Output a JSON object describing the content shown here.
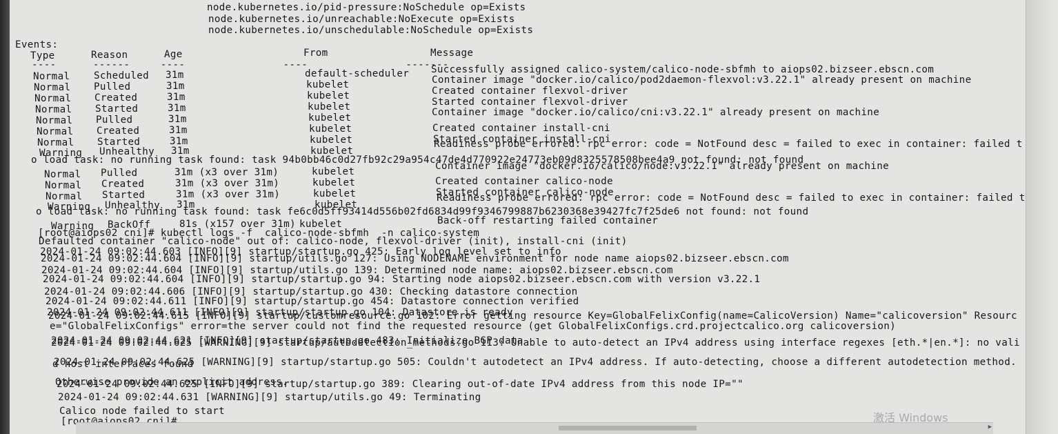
{
  "terminal": {
    "top_tolerations": [
      "node.kubernetes.io/pid-pressure:NoSchedule op=Exists",
      "node.kubernetes.io/unreachable:NoExecute op=Exists",
      "node.kubernetes.io/unschedulable:NoSchedule op=Exists"
    ],
    "events_label": "Events:",
    "events_header": {
      "type": "Type",
      "reason": "Reason",
      "age": "Age",
      "from": "From",
      "message": "Message"
    },
    "events_rows": [
      {
        "type": "Normal",
        "reason": "Scheduled",
        "age": "31m",
        "from": "default-scheduler",
        "message": "Successfully assigned calico-system/calico-node-sbfmh to aiops02.bizseer.ebscn.com"
      },
      {
        "type": "Normal",
        "reason": "Pulled",
        "age": "31m",
        "from": "kubelet",
        "message": "Container image \"docker.io/calico/pod2daemon-flexvol:v3.22.1\" already present on machine"
      },
      {
        "type": "Normal",
        "reason": "Created",
        "age": "31m",
        "from": "kubelet",
        "message": "Created container flexvol-driver"
      },
      {
        "type": "Normal",
        "reason": "Started",
        "age": "31m",
        "from": "kubelet",
        "message": "Started container flexvol-driver"
      },
      {
        "type": "Normal",
        "reason": "Pulled",
        "age": "31m",
        "from": "kubelet",
        "message": "Container image \"docker.io/calico/cni:v3.22.1\" already present on machine"
      },
      {
        "type": "Normal",
        "reason": "Created",
        "age": "31m",
        "from": "kubelet",
        "message": "Created container install-cni"
      },
      {
        "type": "Normal",
        "reason": "Started",
        "age": "31m",
        "from": "kubelet",
        "message": "Started container install-cni"
      },
      {
        "type": "Warning",
        "reason": "Unhealthy",
        "age": "31m",
        "from": "kubelet",
        "message": "Readiness probe errored: rpc error: code = NotFound desc = failed to exec in container: failed t"
      }
    ],
    "events_wrap_1": "o load task: no running task found: task 94b0bb46c0d27fb92c29a954c47de4d770922e24773eb09d8325578508bee4a9 not found: not found",
    "events_rows_2": [
      {
        "type": "Normal",
        "reason": "Pulled",
        "age": "31m (x3 over 31m)",
        "from": "kubelet",
        "message": "Container image \"docker.io/calico/node:v3.22.1\" already present on machine"
      },
      {
        "type": "Normal",
        "reason": "Created",
        "age": "31m (x3 over 31m)",
        "from": "kubelet",
        "message": "Created container calico-node"
      },
      {
        "type": "Normal",
        "reason": "Started",
        "age": "31m (x3 over 31m)",
        "from": "kubelet",
        "message": "Started container calico-node"
      },
      {
        "type": "Warning",
        "reason": "Unhealthy",
        "age": "31m",
        "from": "kubelet",
        "message": "Readiness probe errored: rpc error: code = NotFound desc = failed to exec in container: failed t"
      }
    ],
    "events_wrap_2": "o load task: no running task found: task fe6c0d5ff93414d556b02fd6834d99f9346799887b6230368e39427fc7f25de6 not found: not found",
    "events_row_backoff": {
      "type": "Warning",
      "reason": "BackOff",
      "age": "81s (x157 over 31m)",
      "from": "kubelet",
      "message": "Back-off restarting failed container"
    },
    "prompt_cmd": "[root@aiops02 cni]# kubectl logs -f  calico-node-sbfmh  -n calico-system",
    "defaulted_line": "Defaulted container \"calico-node\" out of: calico-node, flexvol-driver (init), install-cni (init)",
    "log_lines": [
      "2024-01-24 09:02:44.603 [INFO][9] startup/startup.go 425: Early log level set to info",
      "2024-01-24 09:02:44.604 [INFO][9] startup/utils.go 127: Using NODENAME environment for node name aiops02.bizseer.ebscn.com",
      "2024-01-24 09:02:44.604 [INFO][9] startup/utils.go 139: Determined node name: aiops02.bizseer.ebscn.com",
      "2024-01-24 09:02:44.604 [INFO][9] startup/startup.go 94: Starting node aiops02.bizseer.ebscn.com with version v3.22.1",
      "2024-01-24 09:02:44.606 [INFO][9] startup/startup.go 430: Checking datastore connection",
      "2024-01-24 09:02:44.611 [INFO][9] startup/startup.go 454: Datastore connection verified",
      "2024-01-24 09:02:44.611 [INFO][9] startup/startup.go 104: Datastore is ready",
      "2024-01-24 09:02:44.615 [INFO][9] startup/customresource.go 102: Error getting resource Key=GlobalFelixConfig(name=CalicoVersion) Name=\"calicoversion\" Resourc",
      "e=\"GlobalFelixConfigs\" error=the server could not find the requested resource (get GlobalFelixConfigs.crd.projectcalico.org calicoversion)",
      "2024-01-24 09:02:44.621 [INFO][9] startup/startup.go 483: Initialize BGP data",
      "2024-01-24 09:02:44.625 [WARNING][9] startup/autodetection_methods.go 113: Unable to auto-detect an IPv4 address using interface regexes [eth.*|en.*]: no vali",
      "d host interfaces found",
      "2024-01-24 09:02:44.625 [WARNING][9] startup/startup.go 505: Couldn't autodetect an IPv4 address. If auto-detecting, choose a different autodetection method.",
      "Otherwise provide an explicit address.",
      "2024-01-24 09:02:44.625 [INFO][9] startup/startup.go 389: Clearing out-of-date IPv4 address from this node IP=\"\"",
      "2024-01-24 09:02:44.631 [WARNING][9] startup/utils.go 49: Terminating",
      "Calico node failed to start",
      "[root@aiops02 cni]#"
    ],
    "watermark": "激活 Windows"
  }
}
